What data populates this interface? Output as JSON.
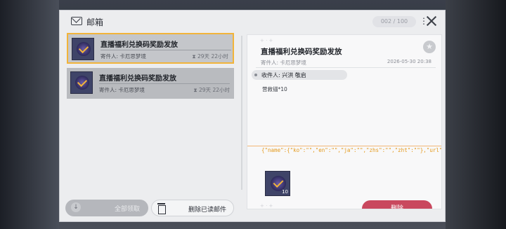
{
  "window": {
    "title": "邮箱",
    "counter": "002 / 100"
  },
  "mail_list": [
    {
      "subject": "直播福利兑换码奖励发放",
      "sender": "寄件人:  卡厄思梦境",
      "expire": "29天 22小时",
      "selected": true
    },
    {
      "subject": "直播福利兑换码奖励发放",
      "sender": "寄件人:  卡厄思梦境",
      "expire": "29天 22小时",
      "selected": false
    }
  ],
  "actions": {
    "claim_all": "全部领取",
    "delete_read": "删除已读邮件"
  },
  "detail": {
    "title": "直播福利兑换码奖励发放",
    "sender": "寄件人:  卡厄思梦境",
    "date": "2026-05-30 20:38",
    "recipient": "收件人:  兴洪 敬启",
    "body": "营救锚*10",
    "raw": "{\"name\":{\"ko\":\"\",\"en\":\"\",\"ja\":\"\",\"zhs\":\"\",\"zht\":\"\"},\"url\":{\"ko\":\"\",\"en\":\"\",\"ja\":\"\",\"zhs\":\"\",\"",
    "attachment_qty": "10",
    "delete_label": "删除"
  },
  "icons": {
    "mail": "envelope-icon",
    "more": "more-vertical-icon",
    "close": "close-icon",
    "star": "star-icon",
    "arrow": "download-arrow-icon",
    "trash": "trash-icon"
  },
  "colors": {
    "selected_border": "#f2b43a",
    "delete_button": "#c9485e",
    "raw_text": "#e49a1c"
  }
}
